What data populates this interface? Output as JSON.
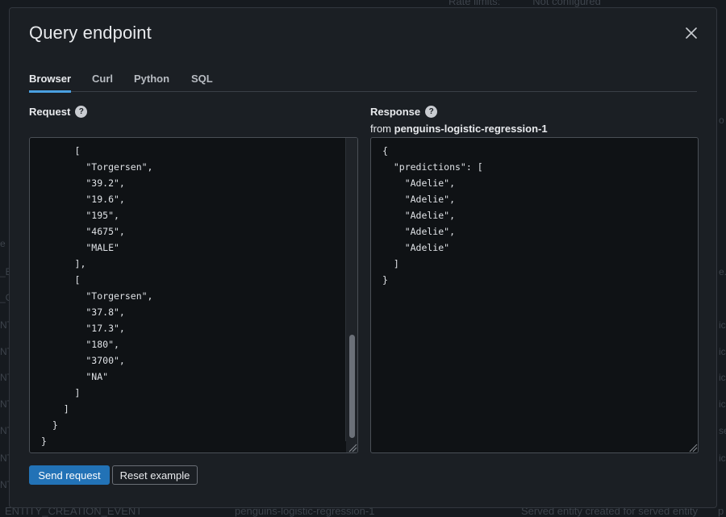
{
  "background": {
    "rate_limits_label": "Rate limits:",
    "rate_limits_value": "Not configured",
    "event_row": {
      "event": "ENTITY_CREATION_EVENT",
      "entity": "penguins-logistic-regression-1",
      "message": "Served entity created for served entity",
      "trailing": "p"
    },
    "right_fragments": [
      "o",
      "e.",
      "ic",
      "ic",
      "ic",
      "ic",
      "se",
      "ic"
    ],
    "left_fragments": [
      "e",
      "_E",
      "_C",
      "NT",
      "NT",
      "NT",
      "NT",
      "NT",
      "NT",
      "NT"
    ]
  },
  "modal": {
    "title": "Query endpoint",
    "close_icon": "close-icon",
    "tabs": [
      {
        "label": "Browser",
        "active": true
      },
      {
        "label": "Curl",
        "active": false
      },
      {
        "label": "Python",
        "active": false
      },
      {
        "label": "SQL",
        "active": false
      }
    ],
    "request": {
      "label": "Request",
      "code_lines": [
        "      [",
        "        \"Torgersen\",",
        "        \"39.2\",",
        "        \"19.6\",",
        "        \"195\",",
        "        \"4675\",",
        "        \"MALE\"",
        "      ],",
        "      [",
        "        \"Torgersen\",",
        "        \"37.8\",",
        "        \"17.3\",",
        "        \"180\",",
        "        \"3700\",",
        "        \"NA\"",
        "      ]",
        "    ]",
        "  }",
        "}"
      ]
    },
    "response": {
      "label": "Response",
      "from_prefix": "from",
      "endpoint_name": "penguins-logistic-regression-1",
      "code_lines": [
        "{",
        "  \"predictions\": [",
        "    \"Adelie\",",
        "    \"Adelie\",",
        "    \"Adelie\",",
        "    \"Adelie\",",
        "    \"Adelie\"",
        "  ]",
        "}"
      ]
    },
    "buttons": {
      "send": "Send request",
      "reset": "Reset example"
    },
    "colors": {
      "accent": "#2272b6",
      "tab_underline": "#4a9fe0"
    }
  }
}
